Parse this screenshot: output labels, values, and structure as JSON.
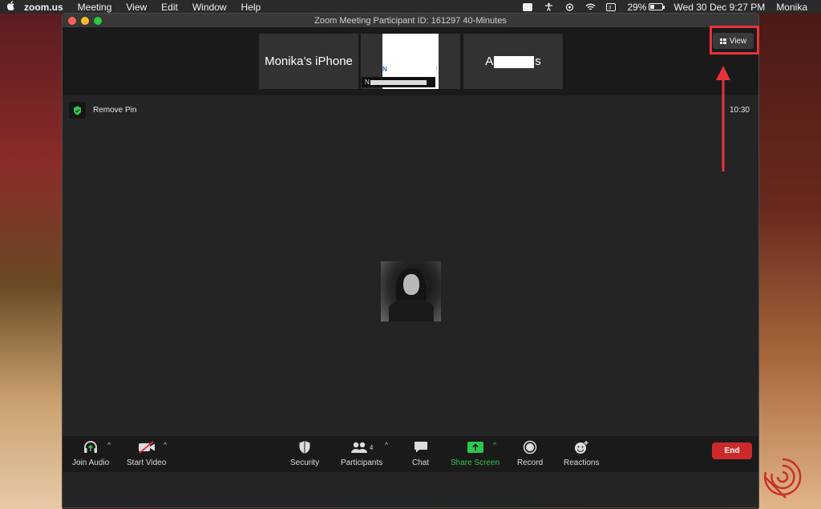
{
  "menubar": {
    "app_name": "zoom.us",
    "items": [
      "Meeting",
      "View",
      "Edit",
      "Window",
      "Help"
    ],
    "battery_percent": "29%",
    "datetime": "Wed 30 Dec  9:27 PM",
    "user": "Monika"
  },
  "window": {
    "title": "Zoom Meeting Participant ID: 161297   40-Minutes"
  },
  "strip": {
    "thumb1_name": "Monika’s iPhone",
    "thumb2_letter": "N",
    "thumb2_name": "N",
    "thumb3_start": "A",
    "thumb3_end": "s",
    "view_label": "View"
  },
  "main": {
    "remove_pin": "Remove Pin",
    "timer": "10:30"
  },
  "toolbar": {
    "join_audio": "Join Audio",
    "start_video": "Start Video",
    "security": "Security",
    "participants": "Participants",
    "participants_count": "4",
    "chat": "Chat",
    "share_screen": "Share Screen",
    "record": "Record",
    "reactions": "Reactions",
    "end": "End"
  },
  "colors": {
    "share_green": "#2ec84d",
    "end_red": "#cc2a2a",
    "highlight_red": "#e8323a"
  }
}
